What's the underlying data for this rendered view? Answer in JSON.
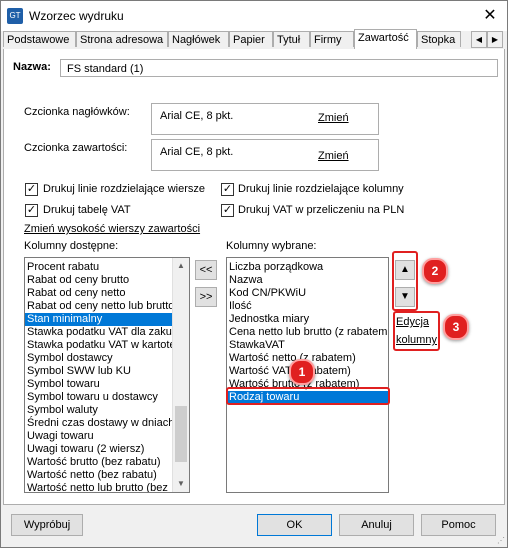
{
  "window": {
    "title": "Wzorzec wydruku",
    "app_icon": "GT",
    "close_glyph": "✕"
  },
  "tabs": [
    "Podstawowe",
    "Strona adresowa",
    "Nagłówek",
    "Papier",
    "Tytuł",
    "Firmy",
    "Zawartość",
    "Stopka"
  ],
  "active_tab": "Zawartość",
  "tab_scroll": {
    "left": "◀",
    "right": "▶"
  },
  "name_field": {
    "label": "Nazwa:",
    "value": "FS standard (1)"
  },
  "fonts": {
    "header_label": "Czcionka nagłówków:",
    "header_value": "Arial CE, 8 pkt.",
    "content_label": "Czcionka zawartości:",
    "content_value": "Arial CE, 8 pkt.",
    "change_link": "Zmień"
  },
  "checkboxes": [
    {
      "label": "Drukuj linie rozdzielające wiersze",
      "checked": true
    },
    {
      "label": "Drukuj linie rozdzielające kolumny",
      "checked": true
    },
    {
      "label": "Drukuj tabelę VAT",
      "checked": true
    },
    {
      "label": "Drukuj VAT w przeliczeniu na PLN",
      "checked": true
    }
  ],
  "check_glyph": "✓",
  "row_height_link": "Zmień wysokość wierszy zawartości",
  "available": {
    "label": "Kolumny dostępne:",
    "items": [
      "Procent rabatu",
      "Rabat od ceny brutto",
      "Rabat od ceny netto",
      "Rabat od ceny netto lub brutto",
      "Stan minimalny",
      "Stawka podatku VAT dla zakupu",
      "Stawka podatku VAT w kartotece",
      "Symbol dostawcy",
      "Symbol SWW lub KU",
      "Symbol towaru",
      "Symbol towaru u dostawcy",
      "Symbol waluty",
      "Średni czas dostawy w dniach",
      "Uwagi towaru",
      "Uwagi towaru (2 wiersz)",
      "Wartość brutto (bez rabatu)",
      "Wartość netto (bez rabatu)",
      "Wartość netto lub brutto (bez"
    ],
    "selected": "Stan minimalny"
  },
  "move_buttons": {
    "add": "<<",
    "remove": ">>"
  },
  "selected_cols": {
    "label": "Kolumny wybrane:",
    "items": [
      "Liczba porządkowa",
      "Nazwa",
      "Kod CN/PKWiU",
      "Ilość",
      "Jednostka miary",
      "Cena netto lub brutto (z rabatem",
      "StawkaVAT",
      "Wartość netto (z rabatem)",
      "Wartość VAT (z rabatem)",
      "Wartość brutto (z rabatem)",
      "Rodzaj towaru"
    ],
    "selected": "Rodzaj towaru"
  },
  "order_buttons": {
    "up": "▲",
    "down": "▼"
  },
  "edit_columns": {
    "line1": "Edycja",
    "line2": "kolumny"
  },
  "badges": [
    "1",
    "2",
    "3"
  ],
  "scroll_glyphs": {
    "up": "▲",
    "down": "▼"
  },
  "footer": {
    "preview": "Wypróbuj",
    "ok": "OK",
    "cancel": "Anuluj",
    "help": "Pomoc"
  },
  "colors": {
    "selection": "#0078d7",
    "callout": "#e02020"
  }
}
